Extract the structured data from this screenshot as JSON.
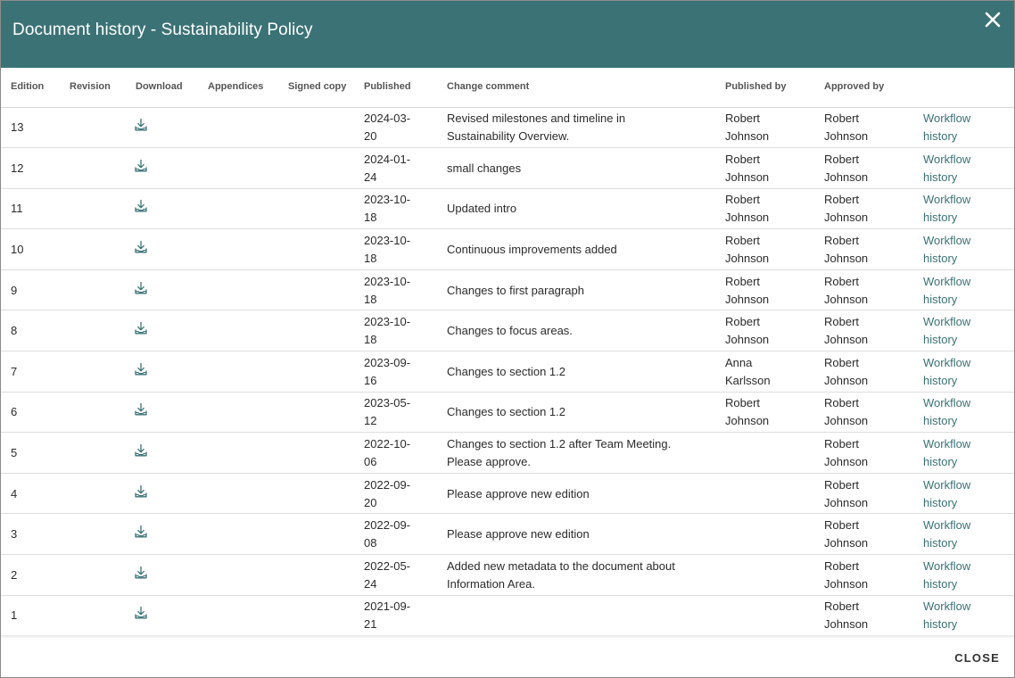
{
  "dialog": {
    "title": "Document history - Sustainability Policy",
    "close_label": "CLOSE"
  },
  "columns": {
    "edition": "Edition",
    "revision": "Revision",
    "download": "Download",
    "appendices": "Appendices",
    "signed_copy": "Signed copy",
    "published": "Published",
    "change_comment": "Change comment",
    "published_by": "Published by",
    "approved_by": "Approved by"
  },
  "workflow_label": "Workflow history",
  "rows": [
    {
      "edition": "13",
      "published": "2024-03-20",
      "comment": "Revised milestones and timeline in Sustainability Overview.",
      "published_by": "Robert Johnson",
      "approved_by": "Robert Johnson"
    },
    {
      "edition": "12",
      "published": "2024-01-24",
      "comment": "small changes",
      "published_by": "Robert Johnson",
      "approved_by": "Robert Johnson"
    },
    {
      "edition": "11",
      "published": "2023-10-18",
      "comment": "Updated intro",
      "published_by": "Robert Johnson",
      "approved_by": "Robert Johnson"
    },
    {
      "edition": "10",
      "published": "2023-10-18",
      "comment": "Continuous improvements added",
      "published_by": "Robert Johnson",
      "approved_by": "Robert Johnson"
    },
    {
      "edition": "9",
      "published": "2023-10-18",
      "comment": "Changes to first paragraph",
      "published_by": "Robert Johnson",
      "approved_by": "Robert Johnson"
    },
    {
      "edition": "8",
      "published": "2023-10-18",
      "comment": "Changes to focus areas.",
      "published_by": "Robert Johnson",
      "approved_by": "Robert Johnson"
    },
    {
      "edition": "7",
      "published": "2023-09-16",
      "comment": "Changes to section 1.2",
      "published_by": "Anna Karlsson",
      "approved_by": "Robert Johnson"
    },
    {
      "edition": "6",
      "published": "2023-05-12",
      "comment": "Changes to section 1.2",
      "published_by": "Robert Johnson",
      "approved_by": "Robert Johnson"
    },
    {
      "edition": "5",
      "published": "2022-10-06",
      "comment": "Changes to section 1.2 after Team Meeting. Please approve.",
      "published_by": "",
      "approved_by": "Robert Johnson"
    },
    {
      "edition": "4",
      "published": "2022-09-20",
      "comment": "Please approve new edition",
      "published_by": "",
      "approved_by": "Robert Johnson"
    },
    {
      "edition": "3",
      "published": "2022-09-08",
      "comment": "Please approve new edition",
      "published_by": "",
      "approved_by": "Robert Johnson"
    },
    {
      "edition": "2",
      "published": "2022-05-24",
      "comment": "Added new metadata to the document about Information Area.",
      "published_by": "",
      "approved_by": "Robert Johnson"
    },
    {
      "edition": "1",
      "published": "2021-09-21",
      "comment": "",
      "published_by": "",
      "approved_by": "Robert Johnson"
    }
  ],
  "colors": {
    "header_bg": "#3b7275",
    "link": "#3b7275"
  },
  "icons": {
    "close": "close-icon",
    "download": "download-icon"
  }
}
